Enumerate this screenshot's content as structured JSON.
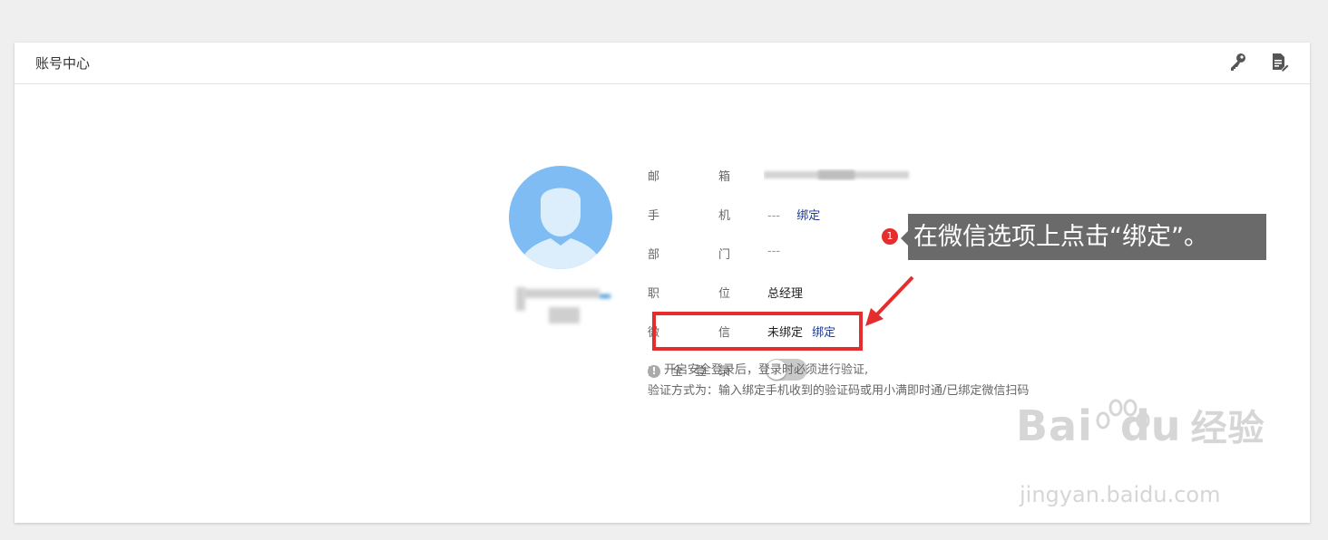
{
  "header": {
    "title": "账号中心"
  },
  "profile": {
    "fields": [
      {
        "label_chars": [
          "邮",
          "箱"
        ],
        "value": ""
      },
      {
        "label_chars": [
          "手",
          "机"
        ],
        "value": "---",
        "link": "绑定"
      },
      {
        "label_chars": [
          "部",
          "门"
        ],
        "value": "---"
      },
      {
        "label_chars": [
          "职",
          "位"
        ],
        "value": "总经理"
      },
      {
        "label_chars": [
          "微",
          "信"
        ],
        "value": "未绑定",
        "link": "绑定"
      },
      {
        "label_chars": [
          "安",
          "全",
          "登",
          "录"
        ],
        "toggle_on": false
      }
    ],
    "notice_line1": "开启安全登录后，登录时必须进行验证,",
    "notice_line2": "验证方式为：输入绑定手机收到的验证码或用小满即时通/已绑定微信扫码"
  },
  "annotation": {
    "step": "1",
    "callout_text": "在微信选项上点击“绑定”。",
    "highlight_color": "#e52d2d"
  },
  "watermark": {
    "brand": "Bai",
    "brand_suffix": "经验",
    "url": "jingyan.baidu.com"
  },
  "colors": {
    "avatar": "#7ebcf3",
    "link": "#1b3a9c",
    "callout_bg": "#6a6a6a"
  }
}
